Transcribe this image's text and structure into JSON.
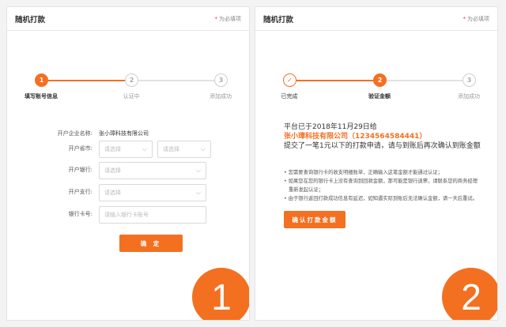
{
  "panel1": {
    "title": "随机打款",
    "required_note": "为必填项",
    "steps": [
      "填写账号信息",
      "认证中",
      "添加成功"
    ],
    "step_numbers": [
      "1",
      "2",
      "3"
    ],
    "form": {
      "company_label": "开户企业名称:",
      "company_value": "张小璋科技有限公司",
      "province_label": "开户省市:",
      "province_placeholder": "请选择",
      "city_placeholder": "请选择",
      "bank_label": "开户银行:",
      "bank_placeholder": "请选择",
      "branch_label": "开户支行:",
      "branch_placeholder": "请选择",
      "card_label": "银行卡号:",
      "card_placeholder": "请输入银行卡账号"
    },
    "confirm_label": "确 定",
    "badge": "1"
  },
  "panel2": {
    "title": "随机打款",
    "required_note": "为必填项",
    "steps": [
      "已完成",
      "验证金额",
      "添加成功"
    ],
    "step_numbers": [
      "✓",
      "2",
      "3"
    ],
    "message_line1": "平台已于2018年11月29日给",
    "message_company": "张小璋科技有限公司（1234564584441）",
    "message_line2": "提交了一笔1元以下的打款申请，请与到账后再次确认到账金额",
    "notes": [
      "• 您需要查询银行卡的收支明细账单，正确输入这笔金额才能通过认证；",
      "• 如果您在您的银行卡上没有查询到回款金额，那可能是银行退票，请联系您的商务经理重新发起认证；",
      "• 由于银行返回打款成功信息有延迟，如知遇实际到账后无法确认金额，请一天后重试。"
    ],
    "confirm_label": "确认打款金额",
    "badge": "2"
  },
  "colors": {
    "accent": "#f37021",
    "required": "#e5383b"
  },
  "icons": {
    "chevron": "chevron-down-icon",
    "check": "check-icon"
  }
}
